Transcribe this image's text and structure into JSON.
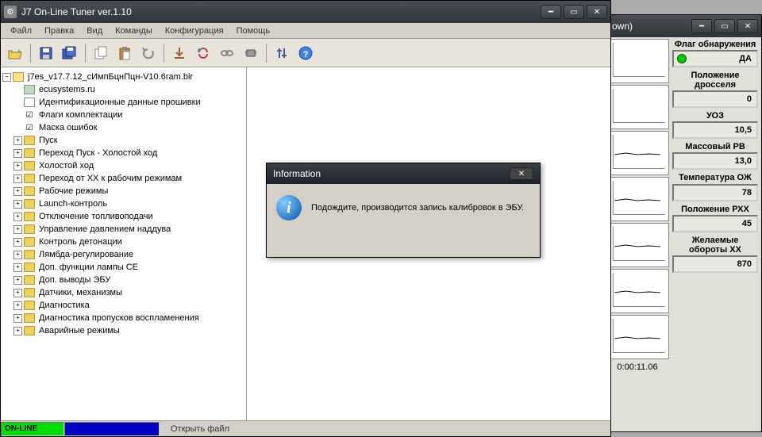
{
  "main_window": {
    "title": "J7 On-Line Tuner ver.1.10",
    "menu": [
      "Файл",
      "Правка",
      "Вид",
      "Команды",
      "Конфигурация",
      "Помощь"
    ]
  },
  "tree": {
    "root": "j7es_v17.7.12_cИмпБцнПцн-V10.6ram.bir",
    "children": [
      {
        "label": "ecusystems.ru",
        "type": "ecu"
      },
      {
        "label": "Идентификационные данные прошивки",
        "type": "file"
      },
      {
        "label": "Флаги комплектации",
        "type": "check"
      },
      {
        "label": "Маска ошибок",
        "type": "check"
      },
      {
        "label": "Пуск",
        "type": "folder",
        "exp": true
      },
      {
        "label": "Переход Пуск - Холостой ход",
        "type": "folder",
        "exp": true
      },
      {
        "label": "Холостой ход",
        "type": "folder",
        "exp": true
      },
      {
        "label": "Переход от XX к рабочим режимам",
        "type": "folder",
        "exp": true
      },
      {
        "label": "Рабочие режимы",
        "type": "folder",
        "exp": true
      },
      {
        "label": "Launch-контроль",
        "type": "folder",
        "exp": true
      },
      {
        "label": "Отключение топливоподачи",
        "type": "folder",
        "exp": true
      },
      {
        "label": "Управление давлением наддува",
        "type": "folder",
        "exp": true
      },
      {
        "label": "Контроль детонации",
        "type": "folder",
        "exp": true
      },
      {
        "label": "Лямбда-регулирование",
        "type": "folder",
        "exp": true
      },
      {
        "label": "Доп. функции лампы CE",
        "type": "folder",
        "exp": true
      },
      {
        "label": "Доп. выводы ЭБУ",
        "type": "folder",
        "exp": true
      },
      {
        "label": "Датчики, механизмы",
        "type": "folder",
        "exp": true
      },
      {
        "label": "Диагностика",
        "type": "folder",
        "exp": true
      },
      {
        "label": "Диагностика пропусков воспламенения",
        "type": "folder",
        "exp": true
      },
      {
        "label": "Аварийные режимы",
        "type": "folder",
        "exp": true
      }
    ]
  },
  "dialog": {
    "title": "Information",
    "message": "Подождите, производится запись калибровок в ЭБУ."
  },
  "status": {
    "online": "ON-LINE",
    "file": "Открыть файл"
  },
  "side": {
    "title_suffix": "own)",
    "timer": "0:00:11.06",
    "panels": [
      {
        "label": "Флаг обнаружения",
        "value": "ДА",
        "flag": true
      },
      {
        "label": "Положение дросселя",
        "value": "0"
      },
      {
        "label": "УОЗ",
        "value": "10,5"
      },
      {
        "label": "Массовый РВ",
        "value": "13,0"
      },
      {
        "label": "Температура ОЖ",
        "value": "78"
      },
      {
        "label": "Положение РХХ",
        "value": "45"
      },
      {
        "label": "Желаемые обороты ХХ",
        "value": "870"
      }
    ]
  }
}
